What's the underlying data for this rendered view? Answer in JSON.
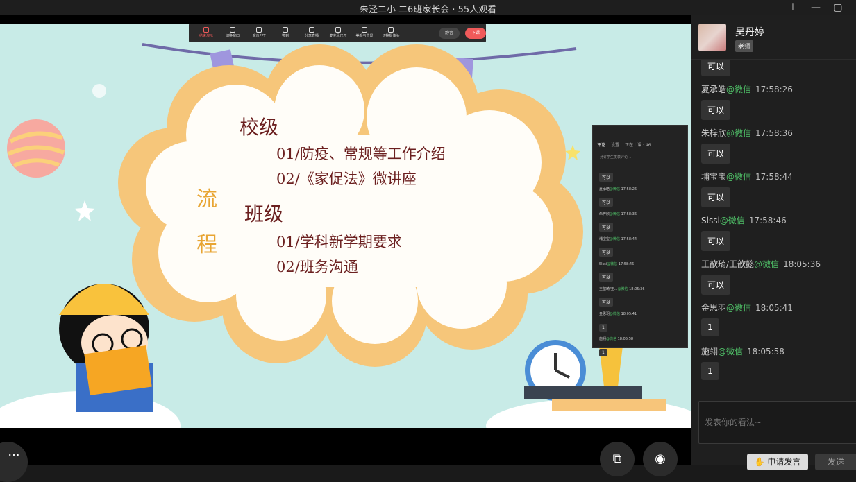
{
  "window": {
    "title": "朱泾二小 二6班家长会 · 55人观看",
    "pin": "⊥",
    "minimize": "—",
    "maximize": "▢"
  },
  "presenter_toolbar": {
    "buttons": [
      "结束演示",
      "切换窗口",
      "演示PPT",
      "签到",
      "分享直播",
      "麦克风已开",
      "美颜与背景",
      "切换摄像头"
    ],
    "mute": "静音",
    "end": "下课"
  },
  "slide": {
    "flow_chars": [
      "流",
      "程"
    ],
    "school_heading": "校级",
    "school_items": [
      "01/防疫、常规等工作介绍",
      "02/《家促法》微讲座"
    ],
    "class_heading": "班级",
    "class_items": [
      "01/学科新学期要求",
      "02/班务沟通"
    ]
  },
  "mini_panel": {
    "tabs": [
      "评论",
      "设置",
      "正在上课 · 46"
    ],
    "subtitle": "允许学生发表评论 ⌄",
    "messages": [
      {
        "name": "",
        "wx": "",
        "time": "",
        "text": "可以"
      },
      {
        "name": "夏承皓",
        "wx": "@微信",
        "time": "17:58:26",
        "text": "可以"
      },
      {
        "name": "朱梓欣",
        "wx": "@微信",
        "time": "17:58:36",
        "text": "可以"
      },
      {
        "name": "埔宝宝",
        "wx": "@微信",
        "time": "17:58:44",
        "text": "可以"
      },
      {
        "name": "Slssi",
        "wx": "@微信",
        "time": "17:58:46",
        "text": "可以"
      },
      {
        "name": "王歆琦/王...",
        "wx": "@微信",
        "time": "18:05:36",
        "text": "可以"
      },
      {
        "name": "金思羽",
        "wx": "@微信",
        "time": "18:05:41",
        "text": "1"
      },
      {
        "name": "施翎",
        "wx": "@微信",
        "time": "18:05:58",
        "text": "1"
      }
    ]
  },
  "bottom_bar": {
    "more": "···",
    "share": "⧉",
    "view": "◉"
  },
  "panel": {
    "teacher_name": "吴丹婷",
    "teacher_badge": "老师",
    "comments": [
      {
        "name": "",
        "wx": "",
        "time": "",
        "text": "可以"
      },
      {
        "name": "夏承皓",
        "wx": "@微信",
        "time": "17:58:26",
        "text": "可以"
      },
      {
        "name": "朱梓欣",
        "wx": "@微信",
        "time": "17:58:36",
        "text": "可以"
      },
      {
        "name": "埔宝宝",
        "wx": "@微信",
        "time": "17:58:44",
        "text": "可以"
      },
      {
        "name": "Slssi",
        "wx": "@微信",
        "time": "17:58:46",
        "text": "可以"
      },
      {
        "name": "王歆琦/王歆懿",
        "wx": "@微信",
        "time": "18:05:36",
        "text": "可以"
      },
      {
        "name": "金思羽",
        "wx": "@微信",
        "time": "18:05:41",
        "text": "1"
      },
      {
        "name": "施翎",
        "wx": "@微信",
        "time": "18:05:58",
        "text": "1"
      }
    ],
    "input_placeholder": "发表你的看法~",
    "apply_label": "✋ 申请发言",
    "send_label": "发送"
  },
  "colors": {
    "wechat_green": "#4fbf67",
    "end_red": "#f05a5a",
    "flow_orange": "#e8a533",
    "slide_text": "#6b1f1f"
  }
}
